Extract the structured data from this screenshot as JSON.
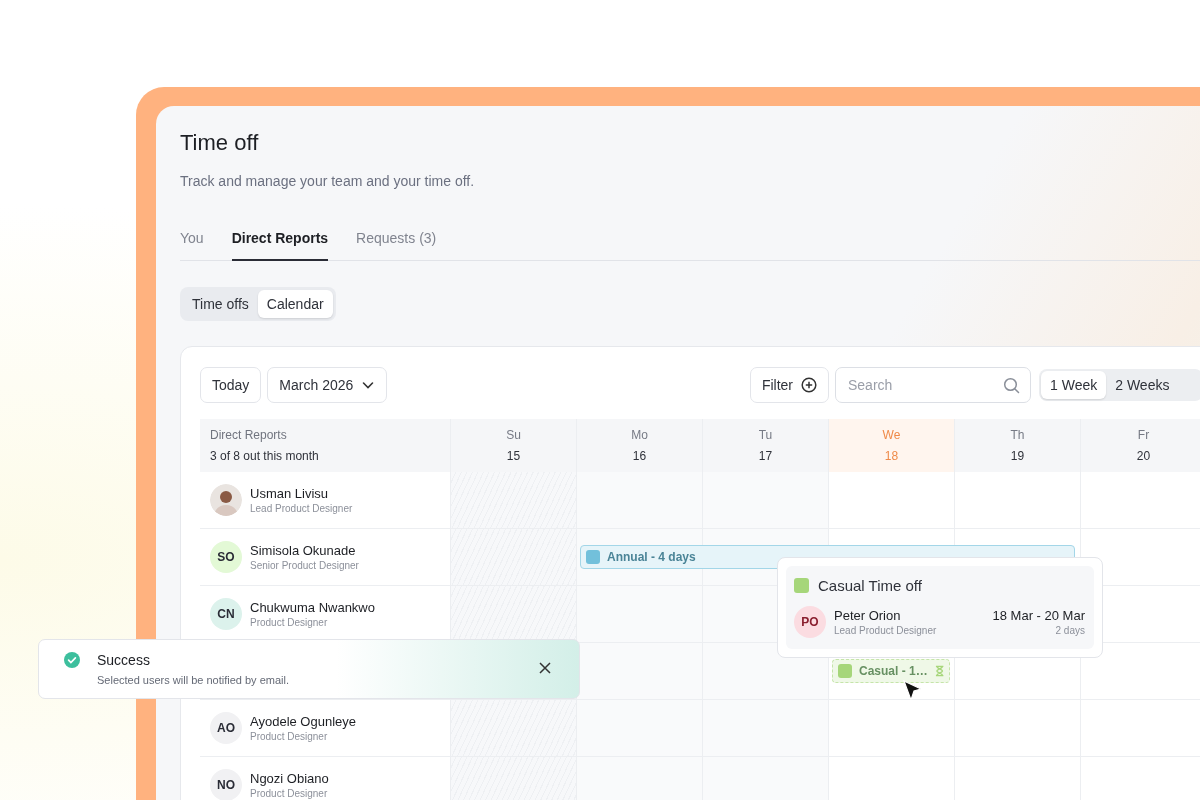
{
  "page": {
    "title": "Time off",
    "subtitle": "Track and manage your team and your time off."
  },
  "tabs": [
    {
      "label": "You",
      "selected": false
    },
    {
      "label": "Direct Reports",
      "selected": true
    },
    {
      "label": "Requests (3)",
      "selected": false
    }
  ],
  "views": [
    {
      "label": "Time offs",
      "selected": false
    },
    {
      "label": "Calendar",
      "selected": true
    }
  ],
  "toolbar": {
    "today": "Today",
    "month": "March 2026",
    "filter": "Filter",
    "search": {
      "placeholder": "Search"
    },
    "ranges": [
      {
        "label": "1 Week",
        "selected": true
      },
      {
        "label": "2 Weeks",
        "selected": false
      }
    ]
  },
  "calendar": {
    "heading": "Direct Reports",
    "summary": "3 of 8 out this month",
    "days": [
      {
        "weekday": "Su",
        "date": "15",
        "kind": "weekend"
      },
      {
        "weekday": "Mo",
        "date": "16",
        "kind": "past"
      },
      {
        "weekday": "Tu",
        "date": "17",
        "kind": "past"
      },
      {
        "weekday": "We",
        "date": "18",
        "kind": "today"
      },
      {
        "weekday": "Th",
        "date": "19",
        "kind": "future"
      },
      {
        "weekday": "Fr",
        "date": "20",
        "kind": "future"
      }
    ],
    "rows": [
      {
        "avatar": {
          "kind": "photo"
        },
        "name": "Usman Livisu",
        "role": "Lead Product Designer",
        "timeline": [
          {
            "kind": "empty"
          },
          {
            "kind": "empty"
          },
          {
            "kind": "empty"
          },
          {
            "kind": "empty"
          },
          {
            "kind": "empty"
          },
          {
            "kind": "empty"
          }
        ]
      },
      {
        "avatar": {
          "kind": "initials",
          "initials": "SO",
          "color": "#e3f9d6"
        },
        "name": "Simisola Okunade",
        "role": "Senior Product Designer",
        "timeline": [
          {
            "kind": "empty"
          },
          {
            "kind": "start",
            "label": "Annual - 4 days",
            "color": "#72c0db",
            "pending": false
          },
          {
            "kind": "continue"
          },
          {
            "kind": "continue"
          },
          {
            "kind": "continue"
          },
          {
            "kind": "empty"
          }
        ]
      },
      {
        "avatar": {
          "kind": "initials",
          "initials": "CN",
          "color": "#dcf2ec"
        },
        "name": "Chukwuma Nwankwo",
        "role": "Product Designer",
        "timeline": [
          {
            "kind": "empty"
          },
          {
            "kind": "empty"
          },
          {
            "kind": "empty"
          },
          {
            "kind": "empty"
          },
          {
            "kind": "empty"
          },
          {
            "kind": "empty"
          }
        ]
      },
      {
        "timeline": [
          {
            "kind": "empty"
          },
          {
            "kind": "empty"
          },
          {
            "kind": "empty"
          },
          {
            "kind": "start",
            "label": "Casual - 1…",
            "color": "#a6d67a",
            "pending": true
          },
          {
            "kind": "empty"
          },
          {
            "kind": "empty"
          }
        ]
      },
      {
        "avatar": {
          "kind": "initials",
          "initials": "AO",
          "color": "#f1f1f3"
        },
        "name": "Ayodele Ogunleye",
        "role": "Product Designer",
        "timeline": [
          {
            "kind": "empty"
          },
          {
            "kind": "empty"
          },
          {
            "kind": "empty"
          },
          {
            "kind": "empty"
          },
          {
            "kind": "empty"
          },
          {
            "kind": "empty"
          }
        ]
      },
      {
        "avatar": {
          "kind": "initials",
          "initials": "NO",
          "color": "#f1f1f3"
        },
        "name": "Ngozi Obiano",
        "role": "Product Designer",
        "timeline": [
          {
            "kind": "empty"
          },
          {
            "kind": "empty"
          },
          {
            "kind": "empty"
          },
          {
            "kind": "empty"
          },
          {
            "kind": "empty"
          },
          {
            "kind": "empty"
          }
        ]
      }
    ]
  },
  "popover": {
    "title": "Casual Time off",
    "color": "#a6d67a",
    "avatar": {
      "initials": "PO",
      "color": "#fbdce1"
    },
    "name": "Peter Orion",
    "role": "Lead Product Designer",
    "dates": "18 Mar - 20 Mar",
    "duration": "2 days"
  },
  "toast": {
    "title": "Success",
    "message": "Selected users will be notified by email."
  }
}
